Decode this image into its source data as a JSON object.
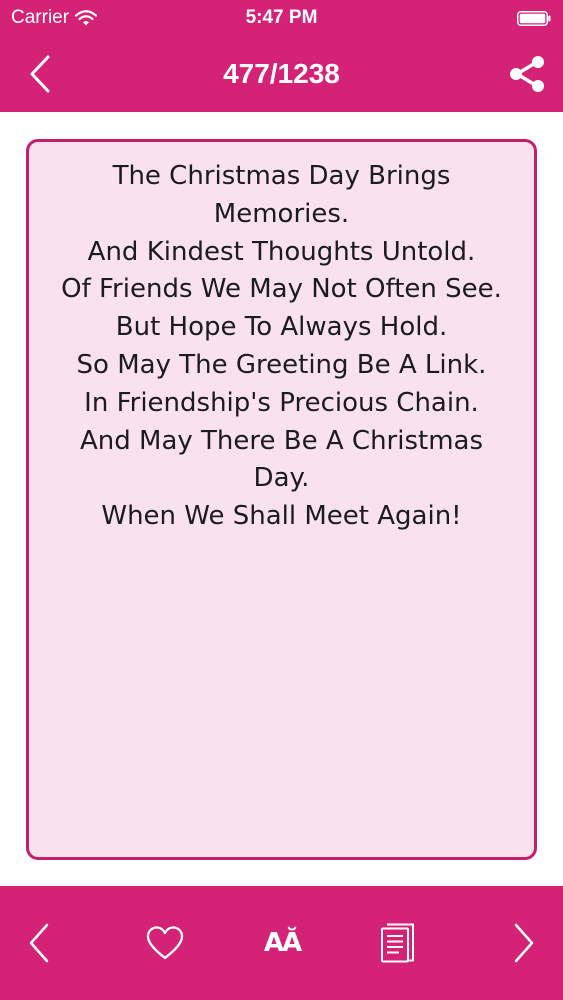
{
  "status_bar": {
    "carrier": "Carrier",
    "time": "5:47 PM",
    "wifi_icon": "wifi-icon",
    "battery_icon": "battery-icon"
  },
  "nav_bar": {
    "title": "477/1238",
    "back_icon": "chevron-left-icon",
    "share_icon": "share-icon"
  },
  "quote": {
    "text": "The Christmas Day Brings\nMemories.\nAnd Kindest Thoughts Untold.\nOf Friends We May Not Often See.\nBut Hope To Always Hold.\nSo May The Greeting Be A Link.\nIn Friendship's Precious Chain.\nAnd May There Be A Christmas\nDay.\nWhen We Shall Meet Again!"
  },
  "toolbar": {
    "previous_icon": "chevron-left-icon",
    "favorite_icon": "heart-icon",
    "font_size_label": "AĂ",
    "copy_icon": "document-icon",
    "next_icon": "chevron-right-icon"
  },
  "colors": {
    "accent": "#d42276",
    "card_background": "#f9e2ee",
    "card_border": "#c41f6d",
    "text": "#1c1c1c"
  }
}
